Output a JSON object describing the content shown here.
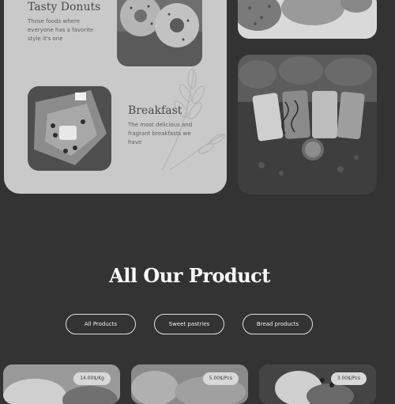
{
  "featured": {
    "donuts": {
      "title": "Tasty Donuts",
      "description": "Those foods where everyone has a favorite style it's one"
    },
    "breakfast": {
      "title": "Breakfast",
      "description": "The most delicious and fragrant breakfasts we have"
    }
  },
  "products_section": {
    "title": "All Our Product",
    "filters": [
      {
        "label": "All Products"
      },
      {
        "label": "Sweet pastries"
      },
      {
        "label": "Bread products"
      }
    ],
    "cards": [
      {
        "price": "14.00$/Kg"
      },
      {
        "price": "5.00$/Pcs"
      },
      {
        "price": "3.00$/Pcs"
      }
    ]
  },
  "colors": {
    "page_background": "#333333",
    "panel_background": "#c9c9c9"
  }
}
